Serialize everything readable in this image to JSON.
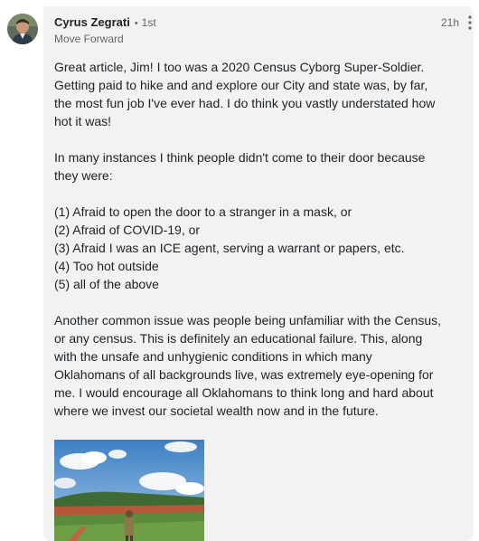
{
  "comment": {
    "author": {
      "name": "Cyrus Zegrati",
      "separator": "•",
      "degree": "1st",
      "headline": "Move Forward"
    },
    "timestamp": "21h",
    "paragraphs": [
      [
        "Great article, Jim! I too was a 2020 Census Cyborg Super-Soldier.",
        "Getting paid to hike and and explore our City and state was, by far,",
        "the most fun job I've ever had. I do think you vastly understated how",
        "hot it was!"
      ],
      [
        "In many instances I think people didn't come to their door because",
        "they were:"
      ],
      [
        "(1) Afraid to open the door to a stranger in a mask, or",
        "(2) Afraid of COVID-19, or",
        "(3) Afraid I was an ICE agent, serving a warrant or papers, etc.",
        "(4) Too hot outside",
        "(5) all of the above"
      ],
      [
        "Another common issue was people being unfamiliar with the Census,",
        "or any census. This is definitely an educational failure.  This, along",
        "with the unsafe and unhygienic conditions in which many",
        "Oklahomans of all backgrounds live, was extremely eye-opening for",
        "me. I would encourage all Oklahomans to think long and hard about",
        "where we invest our societal wealth now and in the future."
      ]
    ]
  },
  "colors": {
    "bubble_background": "#f2f2f2",
    "primary_text": "#1d2226",
    "secondary_text": "#666666"
  },
  "icons": {
    "more_options": "three-dots-vertical-icon"
  }
}
